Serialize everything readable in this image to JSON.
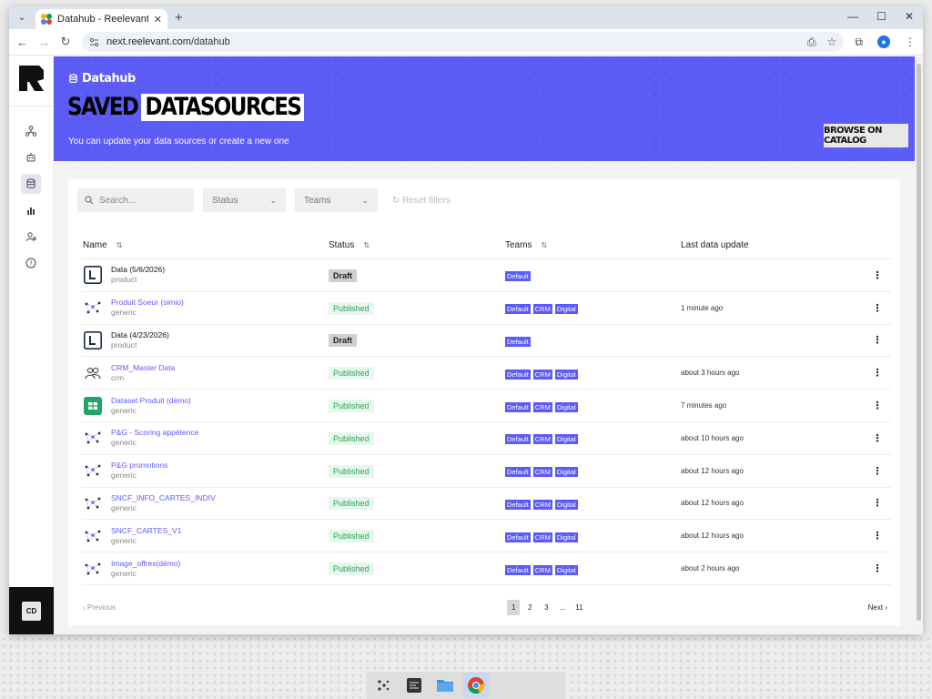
{
  "browser": {
    "tab_title": "Datahub - Reelevant",
    "url_host": "next.reelevant.com",
    "url_path": "/datahub"
  },
  "sidebar": {
    "items": [
      "connections-icon",
      "robot-icon",
      "database-icon",
      "chart-icon",
      "user-settings-icon",
      "help-icon"
    ],
    "user_initials": "CD"
  },
  "hero": {
    "crumb": "Datahub",
    "title_word1": "SAVED",
    "title_word2": "DATASOURCES",
    "subtitle": "You can update your data sources or create a new one",
    "browse_button": "BROWSE ON CATALOG"
  },
  "filters": {
    "search_placeholder": "Search...",
    "status_label": "Status",
    "teams_label": "Teams",
    "reset_label": "Reset filters"
  },
  "table": {
    "headers": {
      "name": "Name",
      "status": "Status",
      "teams": "Teams",
      "last_update": "Last data update"
    },
    "rows": [
      {
        "icon": "letter-l-icon",
        "name": "Data (5/6/2026)",
        "type": "product",
        "link": false,
        "status": "Draft",
        "teams": [
          "Default"
        ],
        "updated": ""
      },
      {
        "icon": "graph-icon",
        "name": "Produit Soeur (simio)",
        "type": "generic",
        "link": true,
        "status": "Published",
        "teams": [
          "Default",
          "CRM",
          "Digital"
        ],
        "updated": "1 minute ago"
      },
      {
        "icon": "letter-l-icon",
        "name": "Data (4/23/2026)",
        "type": "product",
        "link": false,
        "status": "Draft",
        "teams": [
          "Default"
        ],
        "updated": ""
      },
      {
        "icon": "users-icon",
        "name": "CRM_Master Data",
        "type": "crm",
        "link": true,
        "status": "Published",
        "teams": [
          "Default",
          "CRM",
          "Digital"
        ],
        "updated": "about 3 hours ago"
      },
      {
        "icon": "sheets-icon",
        "name": "Dataset Produit (démo)",
        "type": "generic",
        "link": true,
        "status": "Published",
        "teams": [
          "Default",
          "CRM",
          "Digital"
        ],
        "updated": "7 minutes ago"
      },
      {
        "icon": "graph-icon",
        "name": "P&G - Scoring appétence",
        "type": "generic",
        "link": true,
        "status": "Published",
        "teams": [
          "Default",
          "CRM",
          "Digital"
        ],
        "updated": "about 10 hours ago"
      },
      {
        "icon": "graph-icon",
        "name": "P&G promotions",
        "type": "generic",
        "link": true,
        "status": "Published",
        "teams": [
          "Default",
          "CRM",
          "Digital"
        ],
        "updated": "about 12 hours ago"
      },
      {
        "icon": "graph-icon",
        "name": "SNCF_INFO_CARTES_INDIV",
        "type": "generic",
        "link": true,
        "status": "Published",
        "teams": [
          "Default",
          "CRM",
          "Digital"
        ],
        "updated": "about 12 hours ago"
      },
      {
        "icon": "graph-icon",
        "name": "SNCF_CARTES_V1",
        "type": "generic",
        "link": true,
        "status": "Published",
        "teams": [
          "Default",
          "CRM",
          "Digital"
        ],
        "updated": "about 12 hours ago"
      },
      {
        "icon": "graph-icon",
        "name": "Image_offres(démo)",
        "type": "generic",
        "link": true,
        "status": "Published",
        "teams": [
          "Default",
          "CRM",
          "Digital"
        ],
        "updated": "about 2 hours ago"
      }
    ]
  },
  "pagination": {
    "previous": "Previous",
    "next": "Next",
    "pages": [
      "1",
      "2",
      "3",
      "...",
      "11"
    ],
    "current": "1"
  },
  "colors": {
    "brand": "#5b5bf5",
    "published_text": "#2fa15a",
    "published_bg": "#e6f7ec",
    "draft_bg": "#cfcfcf"
  }
}
